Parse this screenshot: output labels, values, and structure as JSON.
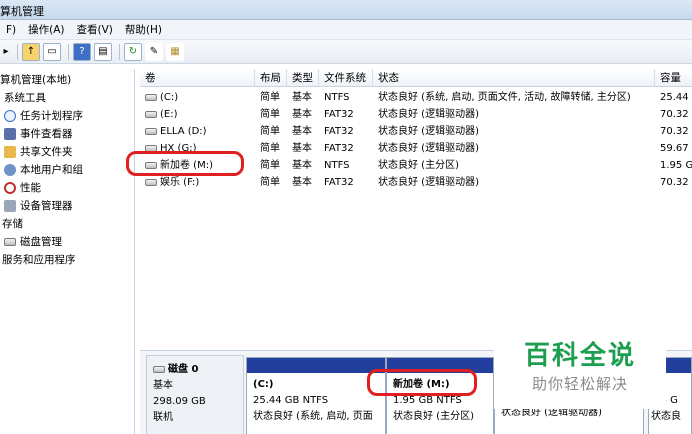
{
  "window": {
    "title": "算机管理"
  },
  "menu": [
    "F)",
    "操作(A)",
    "查看(V)",
    "帮助(H)"
  ],
  "toolbar_icons": [
    "back-icon",
    "forward-icon",
    "up-folder-icon",
    "properties-icon",
    "help-icon",
    "console-icon",
    "refresh-icon",
    "export-icon",
    "wizard-icon"
  ],
  "tree": {
    "items": [
      {
        "label": "算机管理(本地)",
        "icon": "computer-icon"
      },
      {
        "label": "系统工具",
        "icon": ""
      },
      {
        "label": "任务计划程序",
        "icon": "clock-icon"
      },
      {
        "label": "事件查看器",
        "icon": "event-icon"
      },
      {
        "label": "共享文件夹",
        "icon": "folder-icon"
      },
      {
        "label": "本地用户和组",
        "icon": "users-icon"
      },
      {
        "label": "性能",
        "icon": "performance-icon"
      },
      {
        "label": "设备管理器",
        "icon": "device-icon"
      },
      {
        "label": "存储",
        "icon": ""
      },
      {
        "label": "磁盘管理",
        "icon": "disk-icon"
      },
      {
        "label": "服务和应用程序",
        "icon": ""
      }
    ]
  },
  "volumes": {
    "columns": [
      "卷",
      "布局",
      "类型",
      "文件系统",
      "状态",
      "容量"
    ],
    "rows": [
      [
        "(C:)",
        "简单",
        "基本",
        "NTFS",
        "状态良好 (系统, 启动, 页面文件, 活动, 故障转储, 主分区)",
        "25.44"
      ],
      [
        "(E:)",
        "简单",
        "基本",
        "FAT32",
        "状态良好 (逻辑驱动器)",
        "70.32"
      ],
      [
        "ELLA (D:)",
        "简单",
        "基本",
        "FAT32",
        "状态良好 (逻辑驱动器)",
        "70.32"
      ],
      [
        "HX (G:)",
        "简单",
        "基本",
        "FAT32",
        "状态良好 (逻辑驱动器)",
        "59.67"
      ],
      [
        "新加卷 (M:)",
        "简单",
        "基本",
        "NTFS",
        "状态良好 (主分区)",
        "1.95 G"
      ],
      [
        "娱乐 (F:)",
        "简单",
        "基本",
        "FAT32",
        "状态良好 (逻辑驱动器)",
        "70.32"
      ]
    ]
  },
  "disk": {
    "name": "磁盘 0",
    "type": "基本",
    "size": "298.09 GB",
    "status": "联机",
    "partitions": [
      {
        "name": "(C:)",
        "size": "25.44 GB NTFS",
        "status": "状态良好 (系统, 启动, 页面"
      },
      {
        "name": "新加卷 (M:)",
        "size": "1.95 GB NTFS",
        "status": "状态良好 (主分区)"
      },
      {
        "name": "",
        "size": "",
        "status": "状态良好 (逻辑驱动器)"
      },
      {
        "name": "E:)",
        "size": ".34 G",
        "status": "状态良"
      }
    ]
  },
  "watermark": {
    "line1": "百科全说",
    "line2": "助你轻松解决"
  },
  "colors": {
    "partition_bar": "#233f9e",
    "highlight": "#e02020",
    "watermark_green": "#1d9e4f"
  }
}
